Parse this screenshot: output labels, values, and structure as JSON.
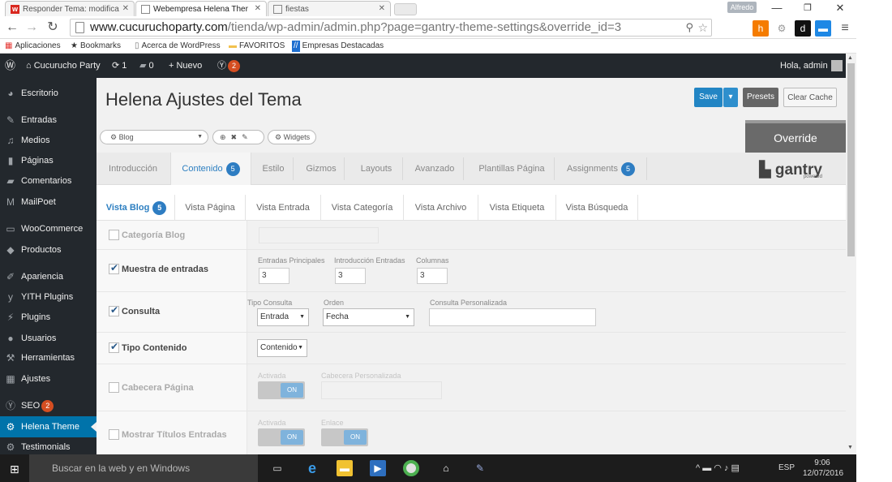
{
  "browser": {
    "tabs": [
      {
        "label": "Responder Tema: modifica",
        "favicon": "w"
      },
      {
        "label": "Webempresa Helena Ther",
        "favicon": ""
      },
      {
        "label": "fiestas",
        "favicon": ""
      }
    ],
    "profile": "Alfredo",
    "url_host": "www.cucuruchoparty.com",
    "url_path": "/tienda/wp-admin/admin.php?page=gantry-theme-settings&override_id=3",
    "bookmarks": [
      "Aplicaciones",
      "Bookmarks",
      "Acerca de WordPress",
      "FAVORITOS",
      "Empresas Destacadas"
    ]
  },
  "adminbar": {
    "site": "Cucurucho Party",
    "updates": "1",
    "comments": "0",
    "new": "Nuevo",
    "seo_count": "2",
    "greeting": "Hola, admin"
  },
  "sidebar": {
    "items": [
      {
        "label": "Escritorio",
        "icon": "dashboard-icon"
      },
      {
        "label": "Entradas",
        "icon": "pin-icon"
      },
      {
        "label": "Medios",
        "icon": "media-icon"
      },
      {
        "label": "Páginas",
        "icon": "page-icon"
      },
      {
        "label": "Comentarios",
        "icon": "comment-icon"
      },
      {
        "label": "MailPoet",
        "icon": "mailpoet-icon"
      },
      {
        "label": "WooCommerce",
        "icon": "woo-icon"
      },
      {
        "label": "Productos",
        "icon": "product-icon"
      },
      {
        "label": "Apariencia",
        "icon": "brush-icon"
      },
      {
        "label": "YITH Plugins",
        "icon": "yith-icon"
      },
      {
        "label": "Plugins",
        "icon": "plug-icon"
      },
      {
        "label": "Usuarios",
        "icon": "user-icon"
      },
      {
        "label": "Herramientas",
        "icon": "wrench-icon"
      },
      {
        "label": "Ajustes",
        "icon": "settings-icon"
      },
      {
        "label": "SEO",
        "icon": "seo-icon",
        "badge": "2"
      },
      {
        "label": "Helena Theme",
        "icon": "gear-icon"
      },
      {
        "label": "Testimonials",
        "icon": "gear-icon"
      }
    ]
  },
  "page": {
    "title": "Helena Ajustes del Tema",
    "save": "Save",
    "presets": "Presets",
    "clear_cache": "Clear Cache",
    "override_select": "Blog",
    "widgets": "Widgets",
    "override": "Override",
    "gantry": "gantry",
    "gantry_sub": "powered",
    "main_tabs": [
      {
        "label": "Introducción"
      },
      {
        "label": "Contenido",
        "count": "5"
      },
      {
        "label": "Estilo"
      },
      {
        "label": "Gizmos"
      },
      {
        "label": "Layouts"
      },
      {
        "label": "Avanzado"
      },
      {
        "label": "Plantillas Página"
      },
      {
        "label": "Assignments",
        "count": "5"
      }
    ],
    "sub_tabs": [
      {
        "label": "Vista Blog",
        "count": "5"
      },
      {
        "label": "Vista Página"
      },
      {
        "label": "Vista Entrada"
      },
      {
        "label": "Vista Categoría"
      },
      {
        "label": "Vista Archivo"
      },
      {
        "label": "Vista Etiqueta"
      },
      {
        "label": "Vista Búsqueda"
      }
    ],
    "rows": {
      "categoria_blog": "Categoría Blog",
      "muestra": "Muestra de entradas",
      "muestra_fields": [
        "Entradas Principales",
        "Introducción Entradas",
        "Columnas"
      ],
      "muestra_values": [
        "3",
        "3",
        "3"
      ],
      "consulta": "Consulta",
      "consulta_fields": [
        "Tipo Consulta",
        "Orden",
        "Consulta Personalizada"
      ],
      "consulta_values": [
        "Entrada",
        "Fecha"
      ],
      "tipo": "Tipo Contenido",
      "tipo_value": "Contenido",
      "cabecera": "Cabecera Página",
      "cabecera_fields": [
        "Activada",
        "Cabecera Personalizada"
      ],
      "titulos": "Mostrar Títulos Entradas",
      "titulos_fields": [
        "Activada",
        "Enlace"
      ],
      "on": "ON"
    }
  },
  "taskbar": {
    "search": "Buscar en la web y en Windows",
    "lang": "ESP",
    "time": "9:06",
    "date": "12/07/2016"
  }
}
